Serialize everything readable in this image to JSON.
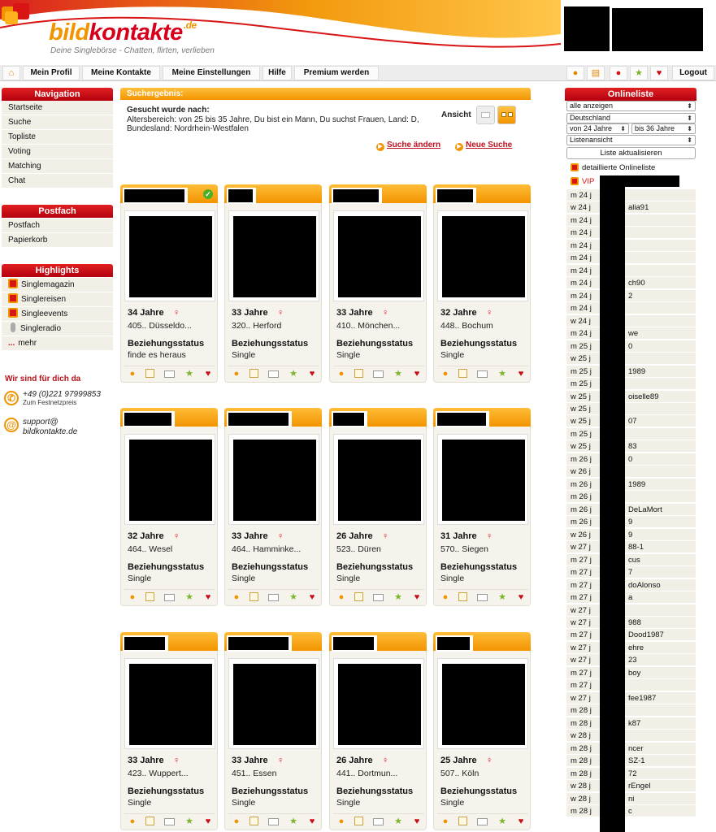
{
  "brand": {
    "logo_part1": "bild",
    "logo_part2": "kontakte",
    "logo_tld": ".de",
    "tagline": "Deine Singlebörse - Chatten, flirten, verlieben",
    "accent": "#f29400",
    "brand_red": "#d5001c"
  },
  "topnav": {
    "home_icon": "home-icon",
    "items": [
      "Mein Profil",
      "Meine Kontakte",
      "Meine Einstellungen",
      "Hilfe",
      "Premium werden"
    ],
    "logout": "Logout"
  },
  "sidebar": {
    "navigation": {
      "title": "Navigation",
      "items": [
        "Startseite",
        "Suche",
        "Topliste",
        "Voting",
        "Matching",
        "Chat"
      ]
    },
    "postfach": {
      "title": "Postfach",
      "items": [
        "Postfach",
        "Papierkorb"
      ]
    },
    "highlights": {
      "title": "Highlights",
      "items": [
        "Singlemagazin",
        "Singlereisen",
        "Singleevents",
        "Singleradio",
        "mehr"
      ],
      "more_prefix": "..."
    },
    "help": {
      "title": "Wir sind für dich da",
      "phone": "+49 (0)221 97999853",
      "phone_note": "Zum Festnetzpreis",
      "email_line1": "support@",
      "email_line2": "bildkontakte.de"
    }
  },
  "results": {
    "header": "Suchergebnis:",
    "searched_label": "Gesucht wurde nach:",
    "searched_text": "Altersbereich: von 25 bis 35 Jahre, Du bist ein Mann, Du suchst Frauen, Land: D, Bundesland: Nordrhein-Westfalen",
    "view_label": "Ansicht",
    "change_search": "Suche ändern",
    "new_search": "Neue Suche",
    "status_label": "Beziehungsstatus",
    "cards": [
      {
        "age": "34 Jahre",
        "location": "405.. Düsseldo...",
        "status": "finde es heraus",
        "verified": true
      },
      {
        "age": "33 Jahre",
        "location": "320.. Herford",
        "status": "Single"
      },
      {
        "age": "33 Jahre",
        "location": "410.. Mönchen...",
        "status": "Single"
      },
      {
        "age": "32 Jahre",
        "location": "448.. Bochum",
        "status": "Single"
      },
      {
        "age": "32 Jahre",
        "location": "464.. Wesel",
        "status": "Single"
      },
      {
        "age": "33 Jahre",
        "location": "464.. Hamminke...",
        "status": "Single"
      },
      {
        "age": "26 Jahre",
        "location": "523.. Düren",
        "status": "Single"
      },
      {
        "age": "31 Jahre",
        "location": "570.. Siegen",
        "status": "Single"
      },
      {
        "age": "33 Jahre",
        "location": "423.. Wuppert...",
        "status": "Single"
      },
      {
        "age": "33 Jahre",
        "location": "451.. Essen",
        "status": "Single"
      },
      {
        "age": "26 Jahre",
        "location": "441.. Dortmun...",
        "status": "Single"
      },
      {
        "age": "25 Jahre",
        "location": "507.. Köln",
        "status": "Single"
      }
    ]
  },
  "online": {
    "title": "Onlineliste",
    "filter_show": "alle anzeigen",
    "filter_country": "Deutschland",
    "age_from": "von 24 Jahre",
    "age_to": "bis 36 Jahre",
    "view_mode": "Listenansicht",
    "refresh": "Liste aktualisieren",
    "detail_link": "detaillierte Onlineliste",
    "vip_label": "VIP",
    "rows": [
      {
        "prefix": "m 24 j",
        "name": ""
      },
      {
        "prefix": "w 24 j",
        "name": "alia91"
      },
      {
        "prefix": "m 24 j",
        "name": ""
      },
      {
        "prefix": "m 24 j",
        "name": ""
      },
      {
        "prefix": "m 24 j",
        "name": ""
      },
      {
        "prefix": "m 24 j",
        "name": ""
      },
      {
        "prefix": "m 24 j",
        "name": ""
      },
      {
        "prefix": "m 24 j",
        "name": "ch90"
      },
      {
        "prefix": "m 24 j",
        "name": "2"
      },
      {
        "prefix": "m 24 j",
        "name": ""
      },
      {
        "prefix": "w 24 j",
        "name": ""
      },
      {
        "prefix": "m 24 j",
        "name": "we"
      },
      {
        "prefix": "m 25 j",
        "name": "0"
      },
      {
        "prefix": "w 25 j",
        "name": ""
      },
      {
        "prefix": "m 25 j",
        "name": "1989"
      },
      {
        "prefix": "m 25 j",
        "name": ""
      },
      {
        "prefix": "w 25 j",
        "name": "oiselle89"
      },
      {
        "prefix": "w 25 j",
        "name": ""
      },
      {
        "prefix": "w 25 j",
        "name": "07"
      },
      {
        "prefix": "m 25 j",
        "name": ""
      },
      {
        "prefix": "w 25 j",
        "name": "83"
      },
      {
        "prefix": "m 26 j",
        "name": "0"
      },
      {
        "prefix": "w 26 j",
        "name": ""
      },
      {
        "prefix": "m 26 j",
        "name": "1989"
      },
      {
        "prefix": "m 26 j",
        "name": ""
      },
      {
        "prefix": "m 26 j",
        "name": "DeLaMort"
      },
      {
        "prefix": "m 26 j",
        "name": "9"
      },
      {
        "prefix": "w 26 j",
        "name": "9"
      },
      {
        "prefix": "w 27 j",
        "name": "88-1"
      },
      {
        "prefix": "m 27 j",
        "name": "cus"
      },
      {
        "prefix": "m 27 j",
        "name": "7"
      },
      {
        "prefix": "m 27 j",
        "name": "doAlonso"
      },
      {
        "prefix": "m 27 j",
        "name": "a"
      },
      {
        "prefix": "w 27 j",
        "name": ""
      },
      {
        "prefix": "w 27 j",
        "name": "988"
      },
      {
        "prefix": "m 27 j",
        "name": "Dood1987"
      },
      {
        "prefix": "w 27 j",
        "name": "ehre"
      },
      {
        "prefix": "w 27 j",
        "name": "23"
      },
      {
        "prefix": "m 27 j",
        "name": "boy"
      },
      {
        "prefix": "m 27 j",
        "name": ""
      },
      {
        "prefix": "w 27 j",
        "name": "fee1987"
      },
      {
        "prefix": "m 28 j",
        "name": ""
      },
      {
        "prefix": "m 28 j",
        "name": "k87"
      },
      {
        "prefix": "w 28 j",
        "name": ""
      },
      {
        "prefix": "m 28 j",
        "name": "ncer"
      },
      {
        "prefix": "m 28 j",
        "name": "SZ-1"
      },
      {
        "prefix": "m 28 j",
        "name": "72"
      },
      {
        "prefix": "w 28 j",
        "name": "rEngel"
      },
      {
        "prefix": "w 28 j",
        "name": "ni"
      },
      {
        "prefix": "m 28 j",
        "name": "c"
      }
    ]
  }
}
